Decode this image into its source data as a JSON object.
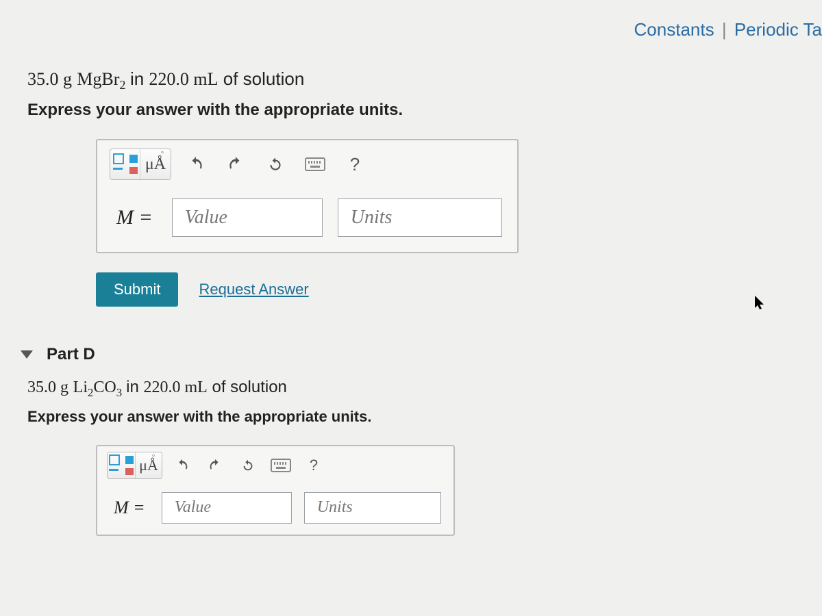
{
  "header": {
    "constants_link": "Constants",
    "separator": "|",
    "periodic_link": "Periodic Ta"
  },
  "partC": {
    "mass": "35.0 g",
    "compound": "MgBr",
    "subscript": "2",
    "in_text": " in ",
    "volume": "220.0 mL",
    "of_text": " of solution",
    "instruction": "Express your answer with the appropriate units.",
    "toolbar": {
      "mua": "μÅ",
      "help": "?"
    },
    "var_label": "M =",
    "value_placeholder": "Value",
    "units_placeholder": "Units",
    "submit": "Submit",
    "request": "Request Answer"
  },
  "partD": {
    "label": "Part D",
    "mass": "35.0 g",
    "compound": "Li",
    "sub1": "2",
    "compound2": "CO",
    "sub2": "3",
    "in_text": " in ",
    "volume": "220.0 mL",
    "of_text": " of solution",
    "instruction": "Express your answer with the appropriate units.",
    "toolbar": {
      "mua": "μÅ",
      "help": "?"
    },
    "var_label": "M =",
    "value_placeholder": "Value",
    "units_placeholder": "Units"
  }
}
